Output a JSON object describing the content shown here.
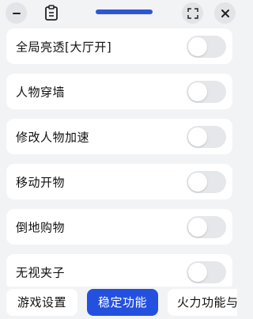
{
  "header": {
    "minimize_icon": "minus-icon",
    "clipboard_icon": "clipboard-icon",
    "expand_icon": "expand-icon",
    "close_icon": "close-icon",
    "accent_color": "#2f55d6"
  },
  "settings": [
    {
      "label": "全局亮透[大厅开]",
      "enabled": false
    },
    {
      "label": "人物穿墙",
      "enabled": false
    },
    {
      "label": "修改人物加速",
      "enabled": false
    },
    {
      "label": "移动开物",
      "enabled": false
    },
    {
      "label": "倒地购物",
      "enabled": false
    },
    {
      "label": "无视夹子",
      "enabled": false
    }
  ],
  "tabs": [
    {
      "label": "游戏设置",
      "active": false
    },
    {
      "label": "稳定功能",
      "active": true
    },
    {
      "label": "火力功能与",
      "active": false
    }
  ],
  "colors": {
    "background": "#f2f3f5",
    "card": "#ffffff",
    "toggle_off": "#e6e7ea",
    "active_tab": "#2450e0"
  }
}
